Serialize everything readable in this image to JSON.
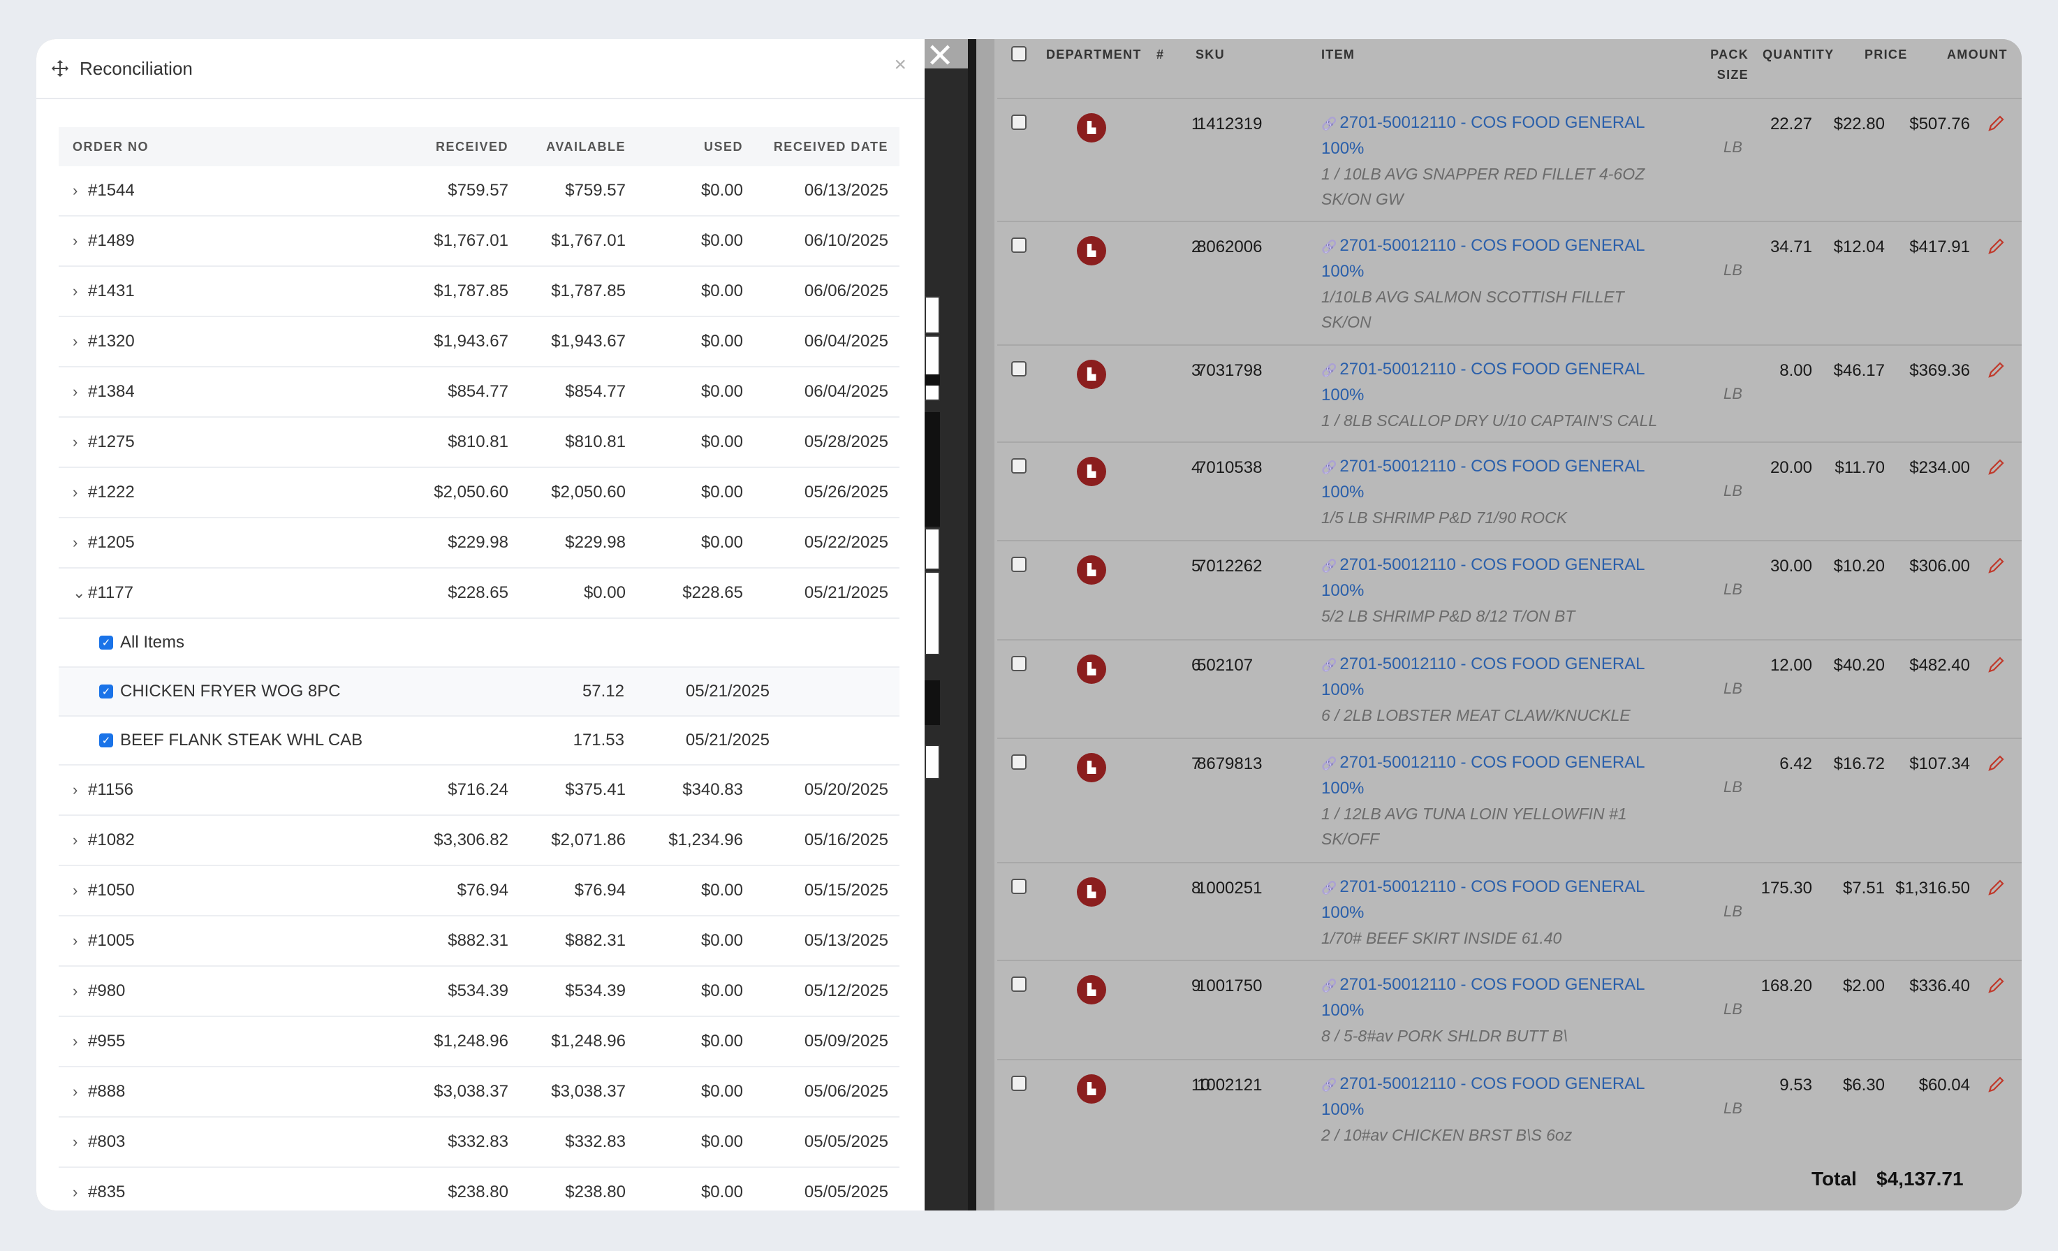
{
  "reconciliation": {
    "title": "Reconciliation",
    "close": "×",
    "columns": {
      "order_no": "ORDER NO",
      "received": "RECEIVED",
      "available": "AVAILABLE",
      "used": "USED",
      "received_date": "RECEIVED DATE"
    },
    "rows": [
      {
        "order": "#1544",
        "received": "$759.57",
        "available": "$759.57",
        "used": "$0.00",
        "date": "06/13/2025",
        "expanded": false
      },
      {
        "order": "#1489",
        "received": "$1,767.01",
        "available": "$1,767.01",
        "used": "$0.00",
        "date": "06/10/2025",
        "expanded": false
      },
      {
        "order": "#1431",
        "received": "$1,787.85",
        "available": "$1,787.85",
        "used": "$0.00",
        "date": "06/06/2025",
        "expanded": false
      },
      {
        "order": "#1320",
        "received": "$1,943.67",
        "available": "$1,943.67",
        "used": "$0.00",
        "date": "06/04/2025",
        "expanded": false
      },
      {
        "order": "#1384",
        "received": "$854.77",
        "available": "$854.77",
        "used": "$0.00",
        "date": "06/04/2025",
        "expanded": false
      },
      {
        "order": "#1275",
        "received": "$810.81",
        "available": "$810.81",
        "used": "$0.00",
        "date": "05/28/2025",
        "expanded": false
      },
      {
        "order": "#1222",
        "received": "$2,050.60",
        "available": "$2,050.60",
        "used": "$0.00",
        "date": "05/26/2025",
        "expanded": false
      },
      {
        "order": "#1205",
        "received": "$229.98",
        "available": "$229.98",
        "used": "$0.00",
        "date": "05/22/2025",
        "expanded": false
      },
      {
        "order": "#1177",
        "received": "$228.65",
        "available": "$0.00",
        "used": "$228.65",
        "date": "05/21/2025",
        "expanded": true
      },
      {
        "order": "#1156",
        "received": "$716.24",
        "available": "$375.41",
        "used": "$340.83",
        "date": "05/20/2025",
        "expanded": false
      },
      {
        "order": "#1082",
        "received": "$3,306.82",
        "available": "$2,071.86",
        "used": "$1,234.96",
        "date": "05/16/2025",
        "expanded": false
      },
      {
        "order": "#1050",
        "received": "$76.94",
        "available": "$76.94",
        "used": "$0.00",
        "date": "05/15/2025",
        "expanded": false
      },
      {
        "order": "#1005",
        "received": "$882.31",
        "available": "$882.31",
        "used": "$0.00",
        "date": "05/13/2025",
        "expanded": false
      },
      {
        "order": "#980",
        "received": "$534.39",
        "available": "$534.39",
        "used": "$0.00",
        "date": "05/12/2025",
        "expanded": false
      },
      {
        "order": "#955",
        "received": "$1,248.96",
        "available": "$1,248.96",
        "used": "$0.00",
        "date": "05/09/2025",
        "expanded": false
      },
      {
        "order": "#888",
        "received": "$3,038.37",
        "available": "$3,038.37",
        "used": "$0.00",
        "date": "05/06/2025",
        "expanded": false
      },
      {
        "order": "#803",
        "received": "$332.83",
        "available": "$332.83",
        "used": "$0.00",
        "date": "05/05/2025",
        "expanded": false
      },
      {
        "order": "#835",
        "received": "$238.80",
        "available": "$238.80",
        "used": "$0.00",
        "date": "05/05/2025",
        "expanded": false
      }
    ],
    "expanded_items": [
      {
        "label": "All Items",
        "checked": true,
        "used": "",
        "date": ""
      },
      {
        "label": "CHICKEN FRYER WOG 8PC",
        "checked": true,
        "used": "57.12",
        "date": "05/21/2025"
      },
      {
        "label": "BEEF FLANK STEAK WHL CAB",
        "checked": true,
        "used": "171.53",
        "date": "05/21/2025"
      }
    ]
  },
  "items_table": {
    "columns": {
      "department": "DEPARTMENT",
      "num": "#",
      "sku": "SKU",
      "item": "ITEM",
      "pack_size_1": "PACK",
      "pack_size_2": "SIZE",
      "quantity": "QUANTITY",
      "price": "PRICE",
      "amount": "AMOUNT"
    },
    "rows": [
      {
        "num": "1",
        "sku": "1412319",
        "link1": "2701-50012110 - COS FOOD GENERAL",
        "link2": "100%",
        "desc": [
          "1 / 10LB AVG SNAPPER RED FILLET 4-6OZ",
          "SK/ON GW"
        ],
        "pack": "LB",
        "qty": "22.27",
        "price": "$22.80",
        "amount": "$507.76"
      },
      {
        "num": "2",
        "sku": "8062006",
        "link1": "2701-50012110 - COS FOOD GENERAL",
        "link2": "100%",
        "desc": [
          "1/10LB AVG SALMON SCOTTISH FILLET",
          "SK/ON"
        ],
        "pack": "LB",
        "qty": "34.71",
        "price": "$12.04",
        "amount": "$417.91"
      },
      {
        "num": "3",
        "sku": "7031798",
        "link1": "2701-50012110 - COS FOOD GENERAL",
        "link2": "100%",
        "desc": [
          "1 / 8LB SCALLOP DRY U/10 CAPTAIN'S CALL"
        ],
        "pack": "LB",
        "qty": "8.00",
        "price": "$46.17",
        "amount": "$369.36"
      },
      {
        "num": "4",
        "sku": "7010538",
        "link1": "2701-50012110 - COS FOOD GENERAL",
        "link2": "100%",
        "desc": [
          "1/5 LB SHRIMP P&D 71/90 ROCK"
        ],
        "pack": "LB",
        "qty": "20.00",
        "price": "$11.70",
        "amount": "$234.00"
      },
      {
        "num": "5",
        "sku": "7012262",
        "link1": "2701-50012110 - COS FOOD GENERAL",
        "link2": "100%",
        "desc": [
          "5/2 LB SHRIMP P&D 8/12 T/ON BT"
        ],
        "pack": "LB",
        "qty": "30.00",
        "price": "$10.20",
        "amount": "$306.00"
      },
      {
        "num": "6",
        "sku": "502107",
        "link1": "2701-50012110 - COS FOOD GENERAL",
        "link2": "100%",
        "desc": [
          "6 / 2LB LOBSTER MEAT CLAW/KNUCKLE"
        ],
        "pack": "LB",
        "qty": "12.00",
        "price": "$40.20",
        "amount": "$482.40"
      },
      {
        "num": "7",
        "sku": "8679813",
        "link1": "2701-50012110 - COS FOOD GENERAL",
        "link2": "100%",
        "desc": [
          "1 / 12LB AVG TUNA LOIN YELLOWFIN #1",
          "SK/OFF"
        ],
        "pack": "LB",
        "qty": "6.42",
        "price": "$16.72",
        "amount": "$107.34"
      },
      {
        "num": "8",
        "sku": "1000251",
        "link1": "2701-50012110 - COS FOOD GENERAL",
        "link2": "100%",
        "desc": [
          "1/70# BEEF SKIRT INSIDE 61.40"
        ],
        "pack": "LB",
        "qty": "175.30",
        "price": "$7.51",
        "amount": "$1,316.50"
      },
      {
        "num": "9",
        "sku": "1001750",
        "link1": "2701-50012110 - COS FOOD GENERAL",
        "link2": "100%",
        "desc": [
          "8 / 5-8#av PORK SHLDR BUTT B\\"
        ],
        "pack": "LB",
        "qty": "168.20",
        "price": "$2.00",
        "amount": "$336.40"
      },
      {
        "num": "10",
        "sku": "1002121",
        "link1": "2701-50012110 - COS FOOD GENERAL",
        "link2": "100%",
        "desc": [
          "2 / 10#av CHICKEN BRST B\\S 6oz"
        ],
        "pack": "LB",
        "qty": "9.53",
        "price": "$6.30",
        "amount": "$60.04"
      }
    ],
    "total_label": "Total",
    "total_value": "$4,137.71"
  },
  "colors": {
    "link": "#2a5faa",
    "badge": "#8b1e1e",
    "edit": "#c0392b",
    "checkbox": "#1a73e8"
  },
  "icons": {
    "move": "move-icon",
    "close": "close-icon",
    "department": "department-icon",
    "edit": "pencil-icon",
    "link": "link-icon",
    "chevron": "chevron-icon"
  }
}
